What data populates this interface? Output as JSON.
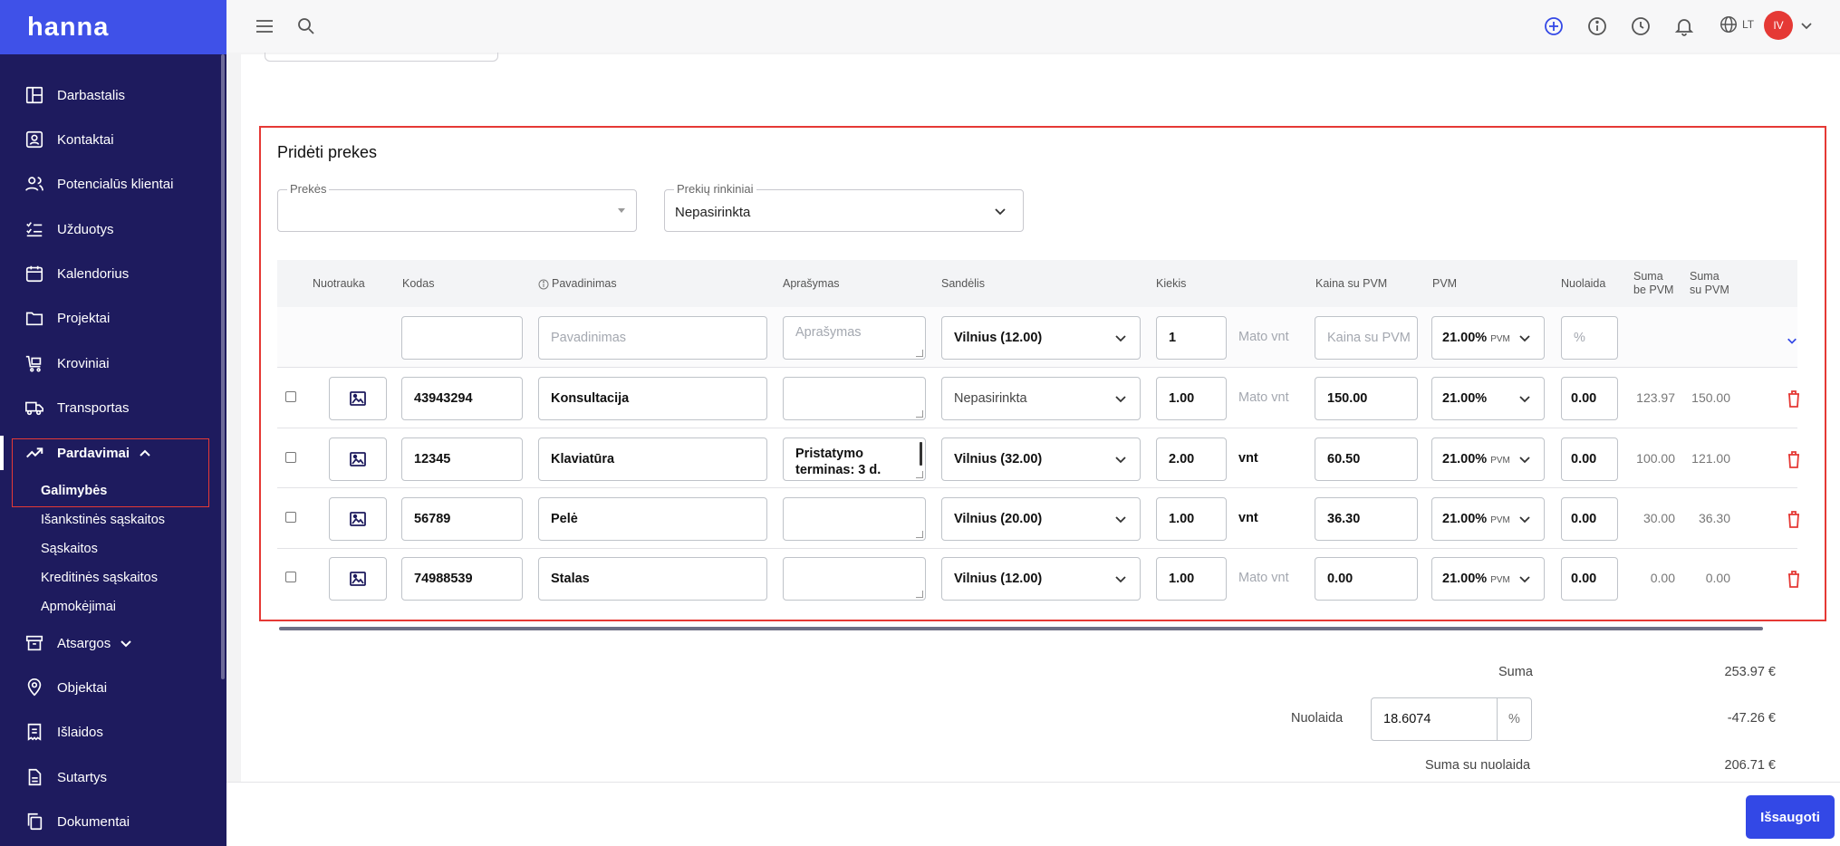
{
  "app": {
    "logo": "hanna"
  },
  "sidebar": {
    "items": [
      {
        "label": "Darbastalis",
        "icon": "dashboard-icon"
      },
      {
        "label": "Kontaktai",
        "icon": "contacts-icon"
      },
      {
        "label": "Potencialūs klientai",
        "icon": "users-icon"
      },
      {
        "label": "Užduotys",
        "icon": "tasks-icon"
      },
      {
        "label": "Kalendorius",
        "icon": "calendar-icon"
      },
      {
        "label": "Projektai",
        "icon": "folder-icon"
      },
      {
        "label": "Kroviniai",
        "icon": "cart-icon"
      },
      {
        "label": "Transportas",
        "icon": "truck-icon"
      },
      {
        "label": "Pardavimai",
        "icon": "trending-icon"
      },
      {
        "label": "Atsargos",
        "icon": "archive-icon"
      },
      {
        "label": "Objektai",
        "icon": "location-icon"
      },
      {
        "label": "Išlaidos",
        "icon": "receipt-icon"
      },
      {
        "label": "Sutartys",
        "icon": "document-icon"
      },
      {
        "label": "Dokumentai",
        "icon": "copy-icon"
      }
    ],
    "sales_sub": [
      "Galimybės",
      "Išankstinės sąskaitos",
      "Sąskaitos",
      "Kreditinės sąskaitos",
      "Apmokėjimai"
    ]
  },
  "topbar": {
    "lang": "LT",
    "avatar": "IV"
  },
  "section": {
    "title": "Pridėti prekes",
    "products_label": "Prekės",
    "products_value": "",
    "sets_label": "Prekių rinkiniai",
    "sets_value": "Nepasirinkta"
  },
  "table": {
    "headers": {
      "photo": "Nuotrauka",
      "code": "Kodas",
      "name": "Pavadinimas",
      "description": "Aprašymas",
      "warehouse": "Sandėlis",
      "quantity": "Kiekis",
      "price_vat": "Kaina su PVM",
      "vat": "PVM",
      "discount": "Nuolaida",
      "sum_no_vat_1": "Suma",
      "sum_no_vat_2": "be PVM",
      "sum_vat_1": "Suma",
      "sum_vat_2": "su PVM"
    },
    "new_row": {
      "code": "",
      "name_placeholder": "Pavadinimas",
      "description_placeholder": "Aprašymas",
      "warehouse": "Vilnius (12.00)",
      "quantity": "1",
      "unit_placeholder": "Mato vnt",
      "price_placeholder": "Kaina su PVM",
      "vat": "21.00%",
      "vat_suffix": "PVM",
      "discount_placeholder": "%"
    },
    "rows": [
      {
        "code": "43943294",
        "name": "Konsultacija",
        "description": "",
        "warehouse": "Nepasirinkta",
        "quantity": "1.00",
        "unit": "Mato vnt",
        "price": "150.00",
        "vat": "21.00%",
        "vat_suffix": "",
        "discount": "0.00",
        "sum_no_vat": "123.97",
        "sum_vat": "150.00"
      },
      {
        "code": "12345",
        "name": "Klaviatūra",
        "description": "Pristatymo terminas: 3 d.",
        "warehouse": "Vilnius (32.00)",
        "quantity": "2.00",
        "unit": "vnt",
        "price": "60.50",
        "vat": "21.00%",
        "vat_suffix": "PVM",
        "discount": "0.00",
        "sum_no_vat": "100.00",
        "sum_vat": "121.00"
      },
      {
        "code": "56789",
        "name": "Pelė",
        "description": "",
        "warehouse": "Vilnius (20.00)",
        "quantity": "1.00",
        "unit": "vnt",
        "price": "36.30",
        "vat": "21.00%",
        "vat_suffix": "PVM",
        "discount": "0.00",
        "sum_no_vat": "30.00",
        "sum_vat": "36.30"
      },
      {
        "code": "74988539",
        "name": "Stalas",
        "description": "",
        "warehouse": "Vilnius (12.00)",
        "quantity": "1.00",
        "unit": "Mato vnt",
        "price": "0.00",
        "vat": "21.00%",
        "vat_suffix": "PVM",
        "discount": "0.00",
        "sum_no_vat": "0.00",
        "sum_vat": "0.00"
      }
    ]
  },
  "totals": {
    "sum_label": "Suma",
    "sum_value": "253.97 €",
    "discount_label": "Nuolaida",
    "discount_input": "18.6074",
    "discount_unit": "%",
    "discount_value": "-47.26 €",
    "after_label": "Suma su nuolaida",
    "after_value": "206.71 €"
  },
  "footer": {
    "save": "Išsaugoti"
  },
  "colors": {
    "sidebar": "#1e1b5e",
    "logo_bg": "#3f51e8",
    "accent": "#3348e6",
    "danger": "#e53935"
  }
}
